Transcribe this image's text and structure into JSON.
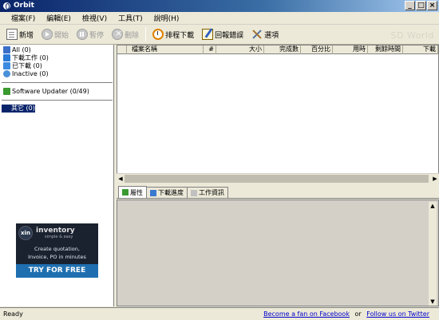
{
  "window": {
    "title": "Orbit",
    "buttons": [
      "_",
      "□",
      "×"
    ]
  },
  "menu": [
    {
      "label": "檔案(F)"
    },
    {
      "label": "編輯(E)"
    },
    {
      "label": "檢視(V)"
    },
    {
      "label": "工具(T)"
    },
    {
      "label": "說明(H)"
    }
  ],
  "toolbar": {
    "new_label": "新增",
    "start_label": "開始",
    "pause_label": "暫停",
    "delete_label": "刪除",
    "schedule_label": "排程下載",
    "report_label": "回報錯誤",
    "options_label": "選項",
    "brand": "SD World"
  },
  "categories": [
    {
      "label": "All (0)",
      "icon": "list-icon"
    },
    {
      "label": "下載工作 (0)",
      "icon": "download-icon"
    },
    {
      "label": "已下載 (0)",
      "icon": "completed-icon"
    },
    {
      "label": "Inactive (0)",
      "icon": "inactive-icon"
    }
  ],
  "updater": {
    "label": "Software Updater (0/49)"
  },
  "other": {
    "label": "其它 (0)"
  },
  "ad": {
    "logo": "xin",
    "brand": "inventory",
    "tagline": "simple & easy",
    "line1": "Create quotation,",
    "line2": "Invoice, PO in minutes",
    "cta": "TRY FOR FREE"
  },
  "columns": [
    "檔案名稱",
    "#",
    "大小",
    "完成數",
    "百分比",
    "用時",
    "剩餘時間",
    "下載"
  ],
  "tabs": [
    {
      "label": "屬性"
    },
    {
      "label": "下載進度"
    },
    {
      "label": "工作資訊"
    }
  ],
  "status": {
    "left": "Ready",
    "facebook": "Become a fan on Facebook",
    "or": "or",
    "twitter": "Follow us on Twitter"
  },
  "colors": {
    "titlebar": "#0a246a",
    "selection": "#0a246a",
    "link": "#0000cc",
    "ad_cta": "#1f6fb0"
  }
}
